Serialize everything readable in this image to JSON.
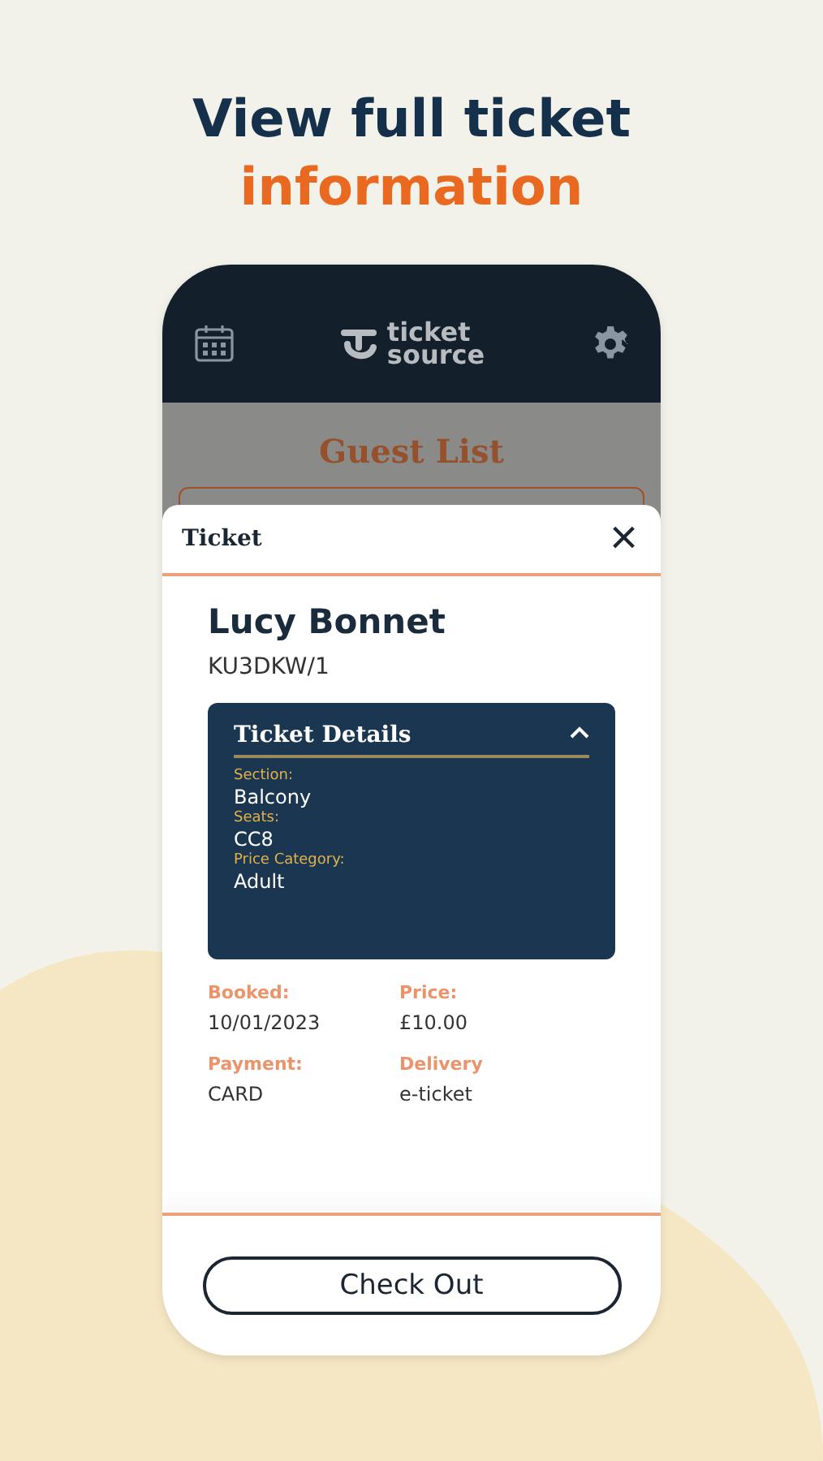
{
  "headline": {
    "line_1": "View full ticket",
    "line_2": "information"
  },
  "app_header": {
    "logo_line_1": "ticket",
    "logo_line_2": "source"
  },
  "background_page": {
    "title": "Guest List"
  },
  "sheet": {
    "title": "Ticket",
    "close": "×"
  },
  "ticket": {
    "name": "Lucy Bonnet",
    "reference": "KU3DKW/1"
  },
  "details": {
    "title": "Ticket Details",
    "expanded": true,
    "fields": [
      {
        "label": "Section:",
        "value": "Balcony"
      },
      {
        "label": "Seats:",
        "value": "CC8"
      },
      {
        "label": "Price Category:",
        "value": "Adult"
      }
    ]
  },
  "summary": [
    {
      "label": "Booked:",
      "value": "10/01/2023"
    },
    {
      "label": "Price:",
      "value": "£10.00"
    },
    {
      "label": "Payment:",
      "value": "CARD"
    },
    {
      "label": "Delivery",
      "value": "e-ticket"
    }
  ],
  "button": "Check Out"
}
